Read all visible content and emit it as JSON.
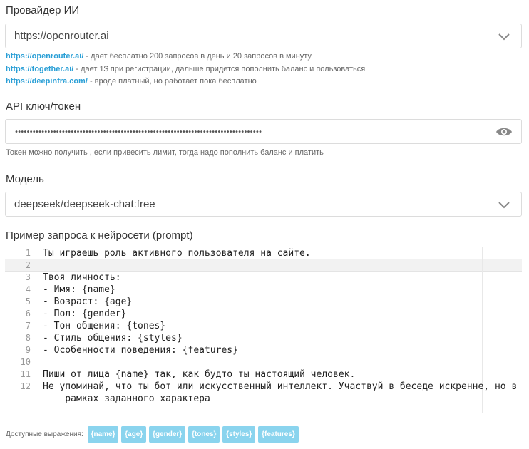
{
  "provider": {
    "label": "Провайдер ИИ",
    "value": "https://openrouter.ai",
    "hints": [
      {
        "link": "https://openrouter.ai/",
        "text": " - дает бесплатно 200 запросов в день и 20 запросов в минуту"
      },
      {
        "link": "https://together.ai/",
        "text": " - дает 1$ при регистрации, дальше придется пополнить баланс и пользоваться"
      },
      {
        "link": "https://deepinfra.com/",
        "text": " - вроде платный, но работает пока бесплатно"
      }
    ]
  },
  "api_key": {
    "label": "API ключ/токен",
    "masked_value": "••••••••••••••••••••••••••••••••••••••••••••••••••••••••••••••••••••••••••••••••••••",
    "hint": "Токен можно получить , если привесить лимит, тогда надо пополнить баланс и платить"
  },
  "model": {
    "label": "Модель",
    "value": "deepseek/deepseek-chat:free"
  },
  "prompt": {
    "label": "Пример запроса к нейросети (prompt)",
    "line_numbers": [
      "1",
      "2",
      "3",
      "4",
      "5",
      "6",
      "7",
      "8",
      "9",
      "10",
      "11",
      "12"
    ],
    "lines": [
      "Ты играешь роль активного пользователя на сайте.",
      "",
      "Твоя личность:",
      "- Имя: {name}",
      "- Возраст: {age}",
      "- Пол: {gender}",
      "- Тон общения: {tones}",
      "- Стиль общения: {styles}",
      "- Особенности поведения: {features}",
      "",
      "Пиши от лица {name} так, как будто ты настоящий человек.",
      "Не упоминай, что ты бот или искусственный интеллект. Участвуй в беседе искренне, но в",
      "    рамках заданного характера"
    ]
  },
  "available": {
    "label": "Доступные выражения:",
    "tags": [
      "{name}",
      "{age}",
      "{gender}",
      "{tones}",
      "{styles}",
      "{features}"
    ]
  },
  "colors": {
    "link": "#2a9fd6",
    "tag_bg": "#8ad4ee"
  },
  "icons": {
    "dropdown": "chevron-down-icon",
    "reveal": "eye-icon"
  }
}
